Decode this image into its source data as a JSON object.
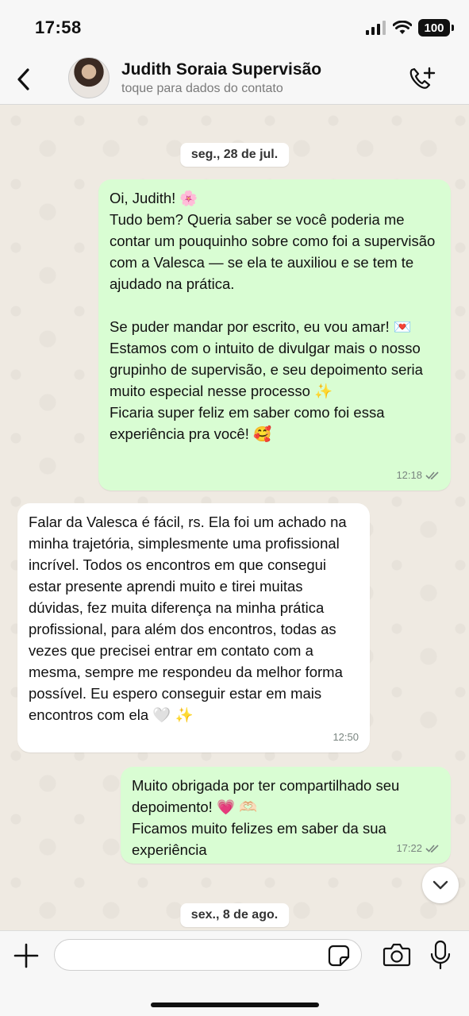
{
  "status_bar": {
    "time": "17:58",
    "battery": "100",
    "icons": [
      "signal-icon",
      "wifi-icon",
      "battery-icon"
    ]
  },
  "header": {
    "contact_name": "Judith Soraia Supervisão",
    "subtitle": "toque para dados do contato",
    "icons": [
      "back-icon",
      "add-call-icon"
    ]
  },
  "chat": {
    "date_1": "seg., 28 de jul.",
    "messages": [
      {
        "direction": "outgoing",
        "text": "Oi, Judith! 🌸\nTudo bem? Queria saber se você poderia me contar um pouquinho sobre como foi a supervisão com a Valesca — se ela te auxiliou e se tem te ajudado na prática.\n\nSe puder mandar por escrito, eu vou amar! 💌\nEstamos com o intuito de divulgar mais o nosso grupinho de supervisão, e seu depoimento seria muito especial nesse processo ✨\nFicaria super feliz em saber como foi essa experiência pra você! 🥰",
        "time": "12:18",
        "status": "read"
      },
      {
        "direction": "incoming",
        "text": "Falar da Valesca é fácil, rs. Ela foi um achado na minha trajetória, simplesmente uma profissional incrível. Todos os encontros em que consegui estar presente aprendi muito e tirei muitas dúvidas, fez muita diferença na minha prática profissional, para além dos encontros, todas as vezes que precisei entrar em contato com a mesma, sempre me respondeu da melhor forma possível. Eu espero conseguir estar em mais encontros com ela 🤍 ✨",
        "time": "12:50"
      },
      {
        "direction": "outgoing",
        "text": "Muito obrigada por ter compartilhado seu depoimento! 💗 🫶🏻\nFicamos muito felizes em saber da sua experiência",
        "time": "17:22",
        "status": "read"
      }
    ],
    "date_2": "sex., 8 de ago."
  },
  "input_bar": {
    "placeholder": "",
    "icons": [
      "plus-icon",
      "sticker-icon",
      "camera-icon",
      "microphone-icon"
    ]
  },
  "colors": {
    "outgoing_bubble": "#d9fdd3",
    "incoming_bubble": "#ffffff",
    "background": "#efeae2",
    "read_check": "#7a8580"
  }
}
